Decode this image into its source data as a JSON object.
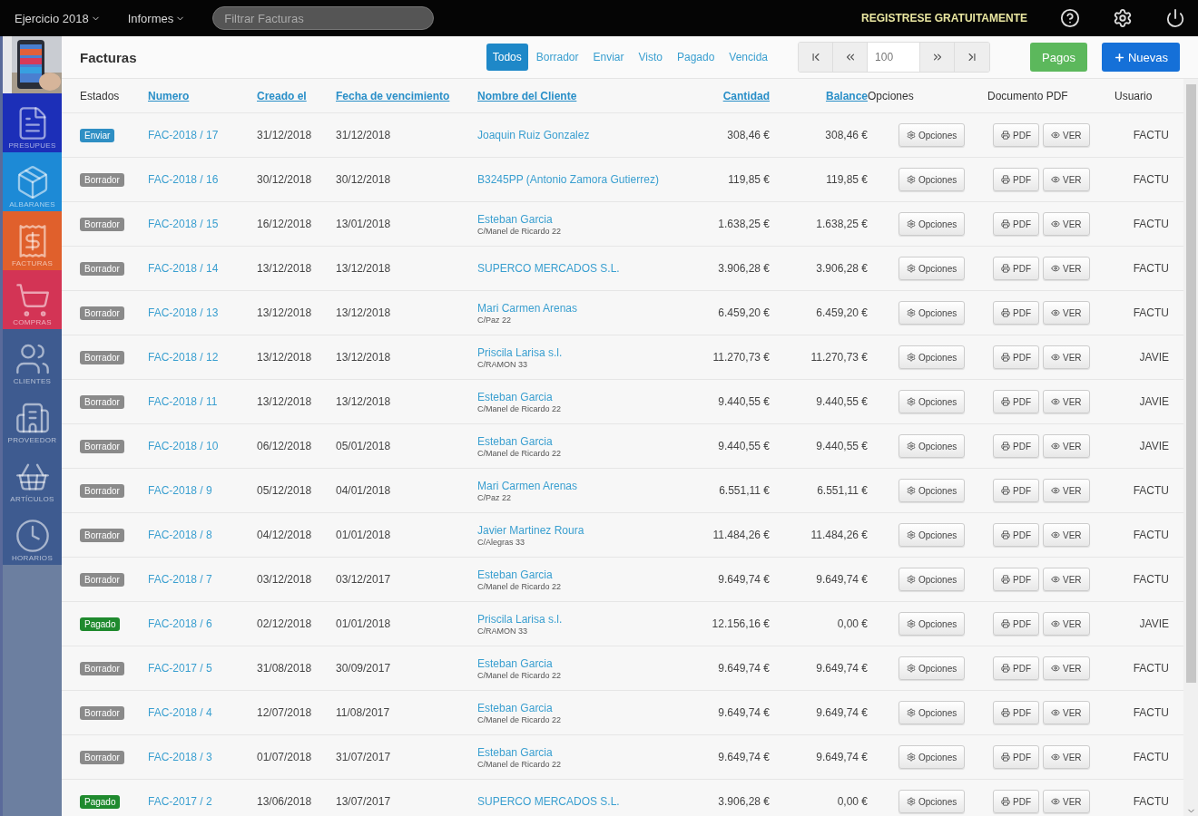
{
  "topbar": {
    "menus": [
      {
        "label": "Ejercicio 2018"
      },
      {
        "label": "Informes"
      }
    ],
    "search": {
      "placeholder": "Filtrar Facturas"
    },
    "register_link": "REGISTRESE GRATUITAMENTE"
  },
  "sidebar": {
    "items": [
      {
        "label": "PRESUPUES",
        "color": "#1c2fb8"
      },
      {
        "label": "ALBARANES",
        "color": "#1d8ad6"
      },
      {
        "label": "FACTURAS",
        "color": "#e0602c"
      },
      {
        "label": "COMPRAS",
        "color": "#d33455"
      },
      {
        "label": "CLIENTES",
        "color": "#3e5b90"
      },
      {
        "label": "PROVEEDOR",
        "color": "#3e5b90"
      },
      {
        "label": "ARTÍCULOS",
        "color": "#3e5b90"
      },
      {
        "label": "HORARIOS",
        "color": "#3e5b90"
      }
    ]
  },
  "page_title": "Facturas",
  "filters": [
    {
      "label": "Todos",
      "selected": true
    },
    {
      "label": "Borrador",
      "selected": false
    },
    {
      "label": "Enviar",
      "selected": false
    },
    {
      "label": "Visto",
      "selected": false
    },
    {
      "label": "Pagado",
      "selected": false
    },
    {
      "label": "Vencida",
      "selected": false
    }
  ],
  "pagination": {
    "page_size": "100"
  },
  "buttons": [
    {
      "label": "Pagos",
      "kind": "success"
    },
    {
      "label": "Nuevas",
      "kind": "primary"
    }
  ],
  "table": {
    "columns": [
      {
        "label": "Estados",
        "sortable": false
      },
      {
        "label": "Numero",
        "sortable": true
      },
      {
        "label": "Creado el",
        "sortable": true
      },
      {
        "label": "Fecha de vencimiento",
        "sortable": true
      },
      {
        "label": "Nombre del Cliente",
        "sortable": true
      },
      {
        "label": "Cantidad",
        "sortable": true
      },
      {
        "label": "Balance",
        "sortable": true
      },
      {
        "label": "Opciones",
        "sortable": false
      },
      {
        "label": "Documento PDF",
        "sortable": false
      },
      {
        "label": "Usuario",
        "sortable": false
      }
    ],
    "rows": [
      {
        "status": {
          "label": "Enviar",
          "color": "#2f8fc4"
        },
        "number": "FAC-2018 / 17",
        "created": "31/12/2018",
        "due": "31/12/2018",
        "client": "Joaquin Ruiz Gonzalez",
        "amount": "308,46 €",
        "balance": "308,46 €",
        "options": "Opciones",
        "pdf": "PDF",
        "view": "VER",
        "user": "FACTU"
      },
      {
        "status": {
          "label": "Borrador",
          "color": "#8a8a8a"
        },
        "number": "FAC-2018 / 16",
        "created": "30/12/2018",
        "due": "30/12/2018",
        "client": "B3245PP (Antonio Zamora Gutierrez)",
        "amount": "119,85 €",
        "balance": "119,85 €",
        "options": "Opciones",
        "pdf": "PDF",
        "view": "VER",
        "user": "FACTU"
      },
      {
        "status": {
          "label": "Borrador",
          "color": "#8a8a8a"
        },
        "number": "FAC-2018 / 15",
        "created": "16/12/2018",
        "due": "13/01/2018",
        "client": "Esteban Garcia",
        "address": "C/Manel de Ricardo 22",
        "amount": "1.638,25 €",
        "balance": "1.638,25 €",
        "options": "Opciones",
        "pdf": "PDF",
        "view": "VER",
        "user": "FACTU"
      },
      {
        "status": {
          "label": "Borrador",
          "color": "#8a8a8a"
        },
        "number": "FAC-2018 / 14",
        "created": "13/12/2018",
        "due": "13/12/2018",
        "client": "SUPERCO MERCADOS S.L.",
        "amount": "3.906,28 €",
        "balance": "3.906,28 €",
        "options": "Opciones",
        "pdf": "PDF",
        "view": "VER",
        "user": "FACTU"
      },
      {
        "status": {
          "label": "Borrador",
          "color": "#8a8a8a"
        },
        "number": "FAC-2018 / 13",
        "created": "13/12/2018",
        "due": "13/12/2018",
        "client": "Mari Carmen Arenas",
        "address": "C/Paz 22",
        "amount": "6.459,20 €",
        "balance": "6.459,20 €",
        "options": "Opciones",
        "pdf": "PDF",
        "view": "VER",
        "user": "FACTU"
      },
      {
        "status": {
          "label": "Borrador",
          "color": "#8a8a8a"
        },
        "number": "FAC-2018 / 12",
        "created": "13/12/2018",
        "due": "13/12/2018",
        "client": "Priscila Larisa s.l.",
        "address": "C/RAMON 33",
        "amount": "11.270,73 €",
        "balance": "11.270,73 €",
        "options": "Opciones",
        "pdf": "PDF",
        "view": "VER",
        "user": "JAVIE"
      },
      {
        "status": {
          "label": "Borrador",
          "color": "#8a8a8a"
        },
        "number": "FAC-2018 / 11",
        "created": "13/12/2018",
        "due": "13/12/2018",
        "client": "Esteban Garcia",
        "address": "C/Manel de Ricardo 22",
        "amount": "9.440,55 €",
        "balance": "9.440,55 €",
        "options": "Opciones",
        "pdf": "PDF",
        "view": "VER",
        "user": "JAVIE"
      },
      {
        "status": {
          "label": "Borrador",
          "color": "#8a8a8a"
        },
        "number": "FAC-2018 / 10",
        "created": "06/12/2018",
        "due": "05/01/2018",
        "client": "Esteban Garcia",
        "address": "C/Manel de Ricardo 22",
        "amount": "9.440,55 €",
        "balance": "9.440,55 €",
        "options": "Opciones",
        "pdf": "PDF",
        "view": "VER",
        "user": "JAVIE"
      },
      {
        "status": {
          "label": "Borrador",
          "color": "#8a8a8a"
        },
        "number": "FAC-2018 / 9",
        "created": "05/12/2018",
        "due": "04/01/2018",
        "client": "Mari Carmen Arenas",
        "address": "C/Paz 22",
        "amount": "6.551,11 €",
        "balance": "6.551,11 €",
        "options": "Opciones",
        "pdf": "PDF",
        "view": "VER",
        "user": "FACTU"
      },
      {
        "status": {
          "label": "Borrador",
          "color": "#8a8a8a"
        },
        "number": "FAC-2018 / 8",
        "created": "04/12/2018",
        "due": "01/01/2018",
        "client": "Javier Martinez Roura",
        "address": "C/Alegras 33",
        "amount": "11.484,26 €",
        "balance": "11.484,26 €",
        "options": "Opciones",
        "pdf": "PDF",
        "view": "VER",
        "user": "FACTU"
      },
      {
        "status": {
          "label": "Borrador",
          "color": "#8a8a8a"
        },
        "number": "FAC-2018 / 7",
        "created": "03/12/2018",
        "due": "03/12/2017",
        "client": "Esteban Garcia",
        "address": "C/Manel de Ricardo 22",
        "amount": "9.649,74 €",
        "balance": "9.649,74 €",
        "options": "Opciones",
        "pdf": "PDF",
        "view": "VER",
        "user": "FACTU"
      },
      {
        "status": {
          "label": "Pagado",
          "color": "#1f8a2e"
        },
        "number": "FAC-2018 / 6",
        "created": "02/12/2018",
        "due": "01/01/2018",
        "client": "Priscila Larisa s.l.",
        "address": "C/RAMON 33",
        "amount": "12.156,16 €",
        "balance": "0,00 €",
        "options": "Opciones",
        "pdf": "PDF",
        "view": "VER",
        "user": "JAVIE"
      },
      {
        "status": {
          "label": "Borrador",
          "color": "#8a8a8a"
        },
        "number": "FAC-2017 / 5",
        "created": "31/08/2018",
        "due": "30/09/2017",
        "client": "Esteban Garcia",
        "address": "C/Manel de Ricardo 22",
        "amount": "9.649,74 €",
        "balance": "9.649,74 €",
        "options": "Opciones",
        "pdf": "PDF",
        "view": "VER",
        "user": "FACTU"
      },
      {
        "status": {
          "label": "Borrador",
          "color": "#8a8a8a"
        },
        "number": "FAC-2018 / 4",
        "created": "12/07/2018",
        "due": "11/08/2017",
        "client": "Esteban Garcia",
        "address": "C/Manel de Ricardo 22",
        "amount": "9.649,74 €",
        "balance": "9.649,74 €",
        "options": "Opciones",
        "pdf": "PDF",
        "view": "VER",
        "user": "FACTU"
      },
      {
        "status": {
          "label": "Borrador",
          "color": "#8a8a8a"
        },
        "number": "FAC-2018 / 3",
        "created": "01/07/2018",
        "due": "31/07/2017",
        "client": "Esteban Garcia",
        "address": "C/Manel de Ricardo 22",
        "amount": "9.649,74 €",
        "balance": "9.649,74 €",
        "options": "Opciones",
        "pdf": "PDF",
        "view": "VER",
        "user": "FACTU"
      },
      {
        "status": {
          "label": "Pagado",
          "color": "#1f8a2e"
        },
        "number": "FAC-2017 / 2",
        "created": "13/06/2018",
        "due": "13/07/2017",
        "client": "SUPERCO MERCADOS S.L.",
        "amount": "3.906,28 €",
        "balance": "0,00 €",
        "options": "Opciones",
        "pdf": "PDF",
        "view": "VER",
        "user": "FACTU"
      }
    ]
  }
}
